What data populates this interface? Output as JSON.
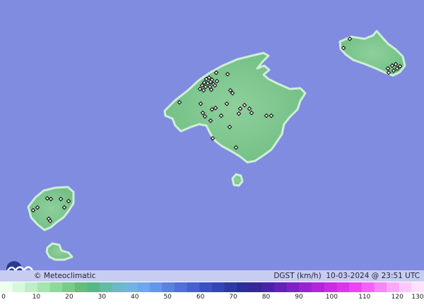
{
  "credit": "© Meteoclimatic",
  "variable": "DGST (km/h)",
  "date": "10-03-2024",
  "at": "@",
  "time": "23:51 UTC",
  "colors": {
    "sea": "#7f8ce0",
    "land": "#79c58a",
    "coast": "#c9ecd1"
  },
  "icons": [
    "meteoclimatic-logo-icon",
    "station-marker-icon"
  ],
  "scale": {
    "ticks": [
      "0",
      "10",
      "20",
      "30",
      "40",
      "50",
      "60",
      "70",
      "80",
      "90",
      "100",
      "110",
      "120",
      "130"
    ],
    "colors": [
      "#eefef0",
      "#d5f8da",
      "#bfeec6",
      "#a6e4b0",
      "#8ed89c",
      "#78cb8a",
      "#63be7c",
      "#57b887",
      "#63bba7",
      "#6bbac7",
      "#74b3e0",
      "#6fa6f0",
      "#6695ec",
      "#5a82e4",
      "#4f6fdc",
      "#4460d2",
      "#3a50c8",
      "#3244b8",
      "#2c3aa6",
      "#2a2e96",
      "#35279a",
      "#4a22aa",
      "#6420bc",
      "#8020ca",
      "#9a22d6",
      "#b424e0",
      "#cc2ae8",
      "#e032ee",
      "#f042f4",
      "#f760f6",
      "#fa84f8",
      "#fca8fa",
      "#fec8fc",
      "#ffe0fe"
    ]
  }
}
